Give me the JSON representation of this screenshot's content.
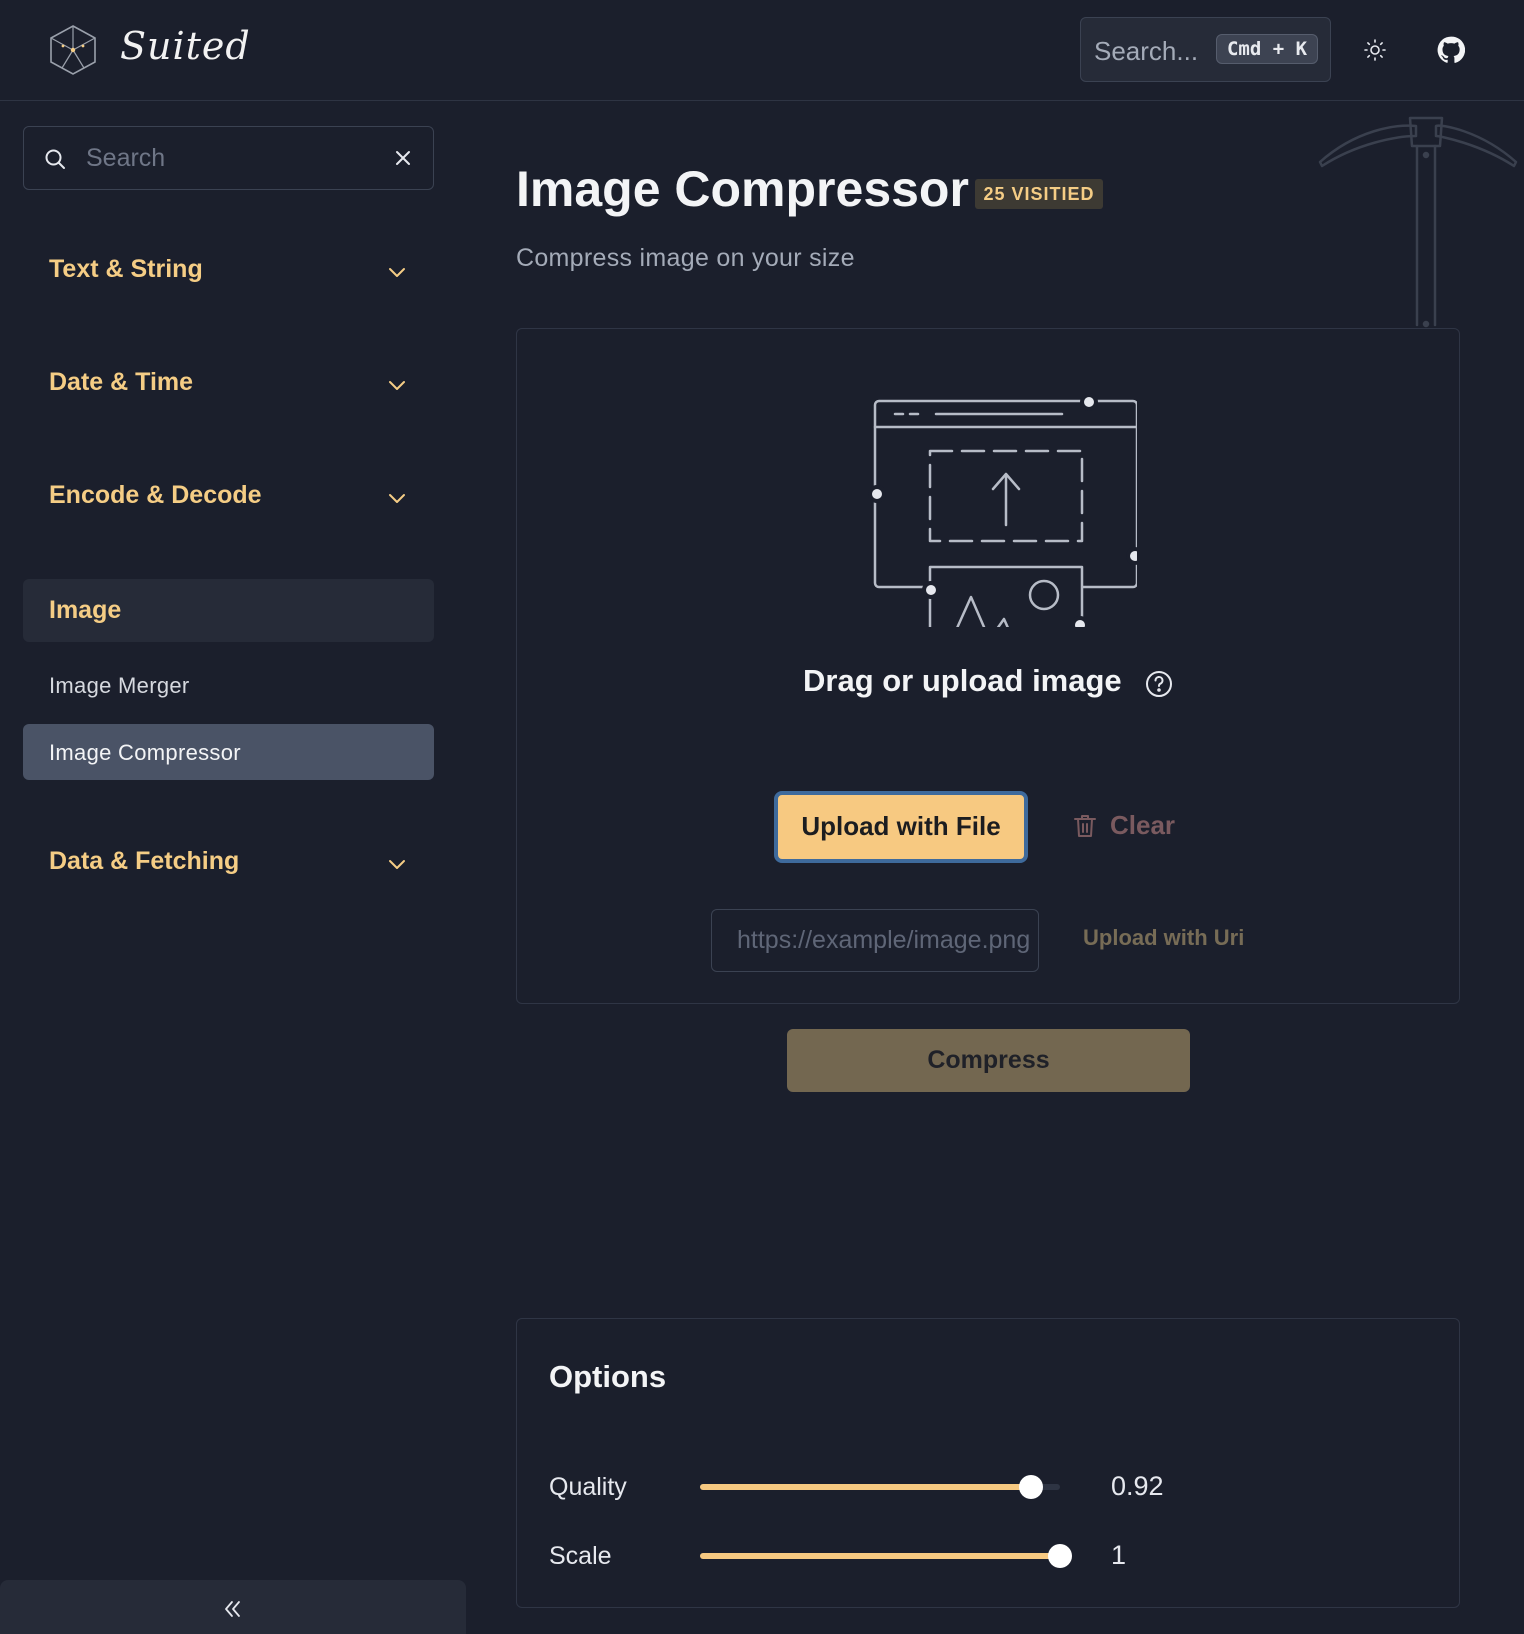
{
  "header": {
    "brand": "Suited",
    "search_placeholder": "Search...",
    "shortcut": "Cmd + K"
  },
  "sidebar": {
    "search_placeholder": "Search",
    "sections": [
      {
        "label": "Text & String"
      },
      {
        "label": "Date & Time"
      },
      {
        "label": "Encode & Decode"
      },
      {
        "label": "Image"
      },
      {
        "label": "Data & Fetching"
      }
    ],
    "image_items": [
      {
        "label": "Image Merger"
      },
      {
        "label": "Image Compressor"
      }
    ],
    "selected_item": "Image Compressor"
  },
  "page": {
    "title": "Image Compressor",
    "visited_badge": "25 VISITIED",
    "subtitle": "Compress image on your size"
  },
  "uploader": {
    "drag_text": "Drag or upload image",
    "upload_file_label": "Upload with File",
    "clear_label": "Clear",
    "uri_placeholder": "https://example/image.png",
    "uri_value": "",
    "upload_uri_label": "Upload with Uri"
  },
  "compress_label": "Compress",
  "options": {
    "title": "Options",
    "quality": {
      "label": "Quality",
      "value": 0.92,
      "display": "0.92"
    },
    "scale": {
      "label": "Scale",
      "value": 1,
      "display": "1"
    }
  },
  "colors": {
    "background": "#1b1f2c",
    "accent": "#f7c981",
    "section_label": "#f5cd85",
    "selected_item_bg": "#4a5366"
  },
  "icons": [
    "logo-cube-icon",
    "sun-icon",
    "github-icon",
    "search-icon",
    "close-icon",
    "chevron-down-icon",
    "help-circle-icon",
    "trash-icon",
    "double-chevron-left-icon",
    "pickaxe-decoration"
  ]
}
